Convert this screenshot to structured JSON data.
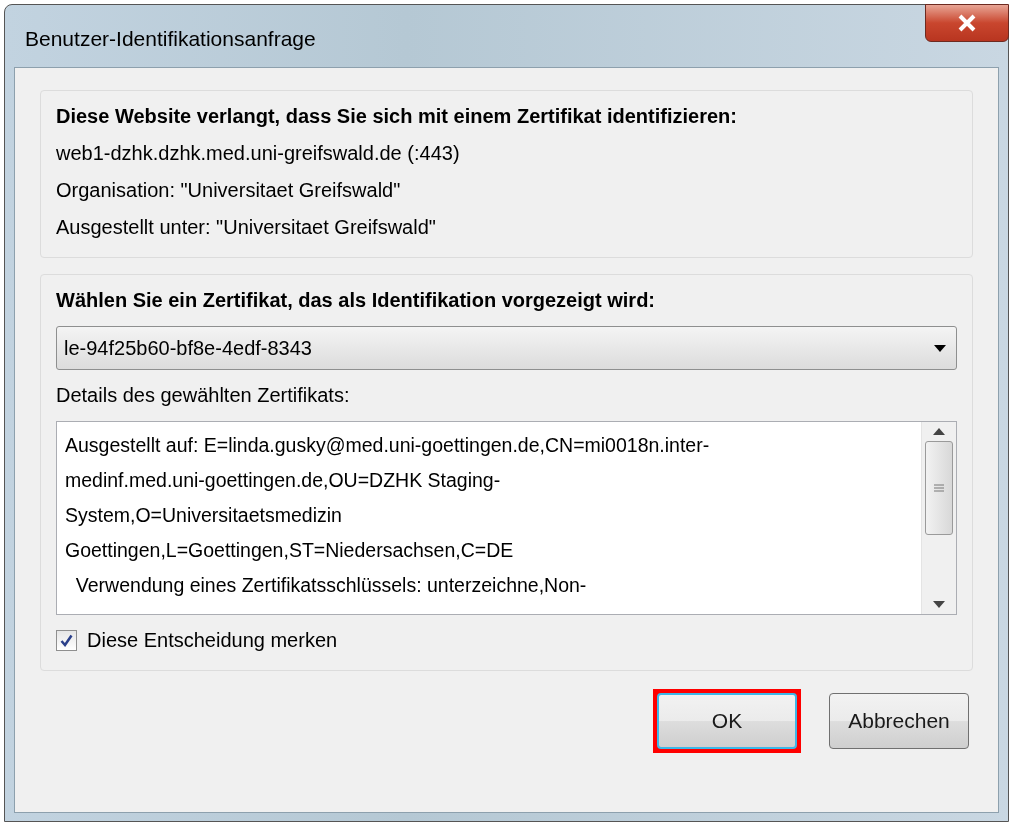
{
  "window": {
    "title": "Benutzer-Identifikationsanfrage"
  },
  "site_info": {
    "heading": "Diese Website verlangt, dass Sie sich mit einem Zertifikat identifizieren:",
    "lines": [
      "web1-dzhk.dzhk.med.uni-greifswald.de (:443)",
      "Organisation: \"Universitaet Greifswald\"",
      "Ausgestellt unter: \"Universitaet Greifswald\""
    ]
  },
  "certificate": {
    "heading": "Wählen Sie ein Zertifikat, das als Identifikation vorgezeigt wird:",
    "selected_value": "le-94f25b60-bf8e-4edf-8343",
    "details_label": "Details des gewählten Zertifikats:",
    "details_lines": [
      "Ausgestellt auf: E=linda.gusky@med.uni-goettingen.de,CN=mi0018n.inter-",
      "medinf.med.uni-goettingen.de,OU=DZHK Staging-",
      "System,O=Universitaetsmedizin",
      "Goettingen,L=Goettingen,ST=Niedersachsen,C=DE",
      "  Verwendung eines Zertifikatsschlüssels: unterzeichne,Non-"
    ],
    "remember": {
      "label": "Diese Entscheidung merken",
      "checked": true
    }
  },
  "buttons": [
    {
      "label": "OK",
      "highlighted": true,
      "default": true
    },
    {
      "label": "Abbrechen",
      "highlighted": false,
      "default": false
    }
  ]
}
